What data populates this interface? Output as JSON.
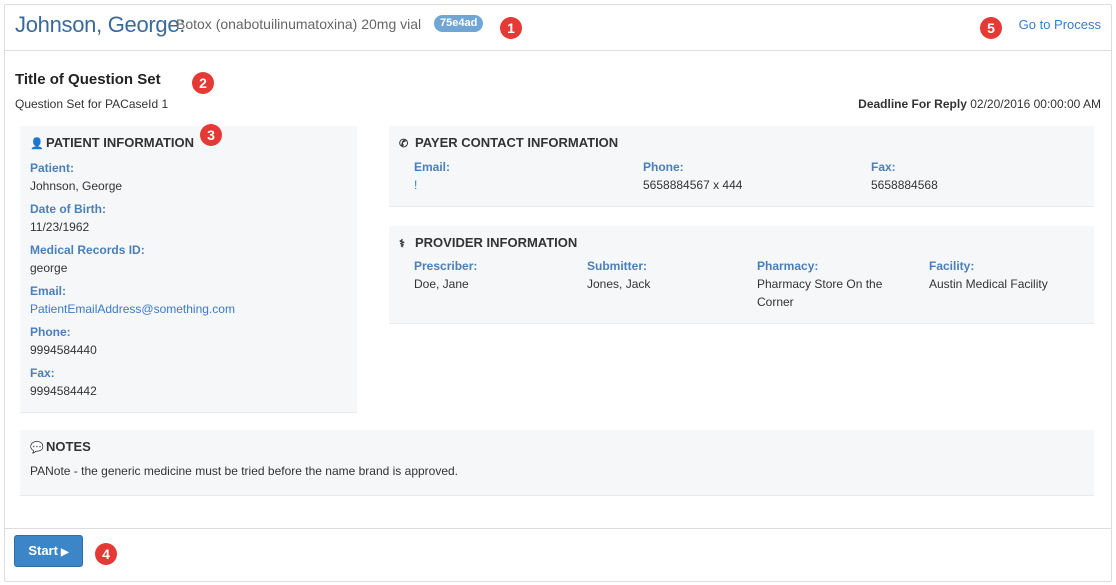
{
  "header": {
    "patient_name": "Johnson, George:",
    "drug": "Botox (onabotuilinumatoxina) 20mg vial",
    "badge": "75e4ad",
    "go_link": "Go to Process"
  },
  "markers": [
    "1",
    "2",
    "3",
    "4",
    "5"
  ],
  "question_set": {
    "title": "Title of Question Set",
    "subtitle": "Question Set for PACaseId 1",
    "deadline_label": "Deadline For Reply",
    "deadline_value": "02/20/2016 00:00:00 AM"
  },
  "patient_info": {
    "title": "PATIENT INFORMATION",
    "icon": "user-icon",
    "fields": [
      {
        "label": "Patient:",
        "value": "Johnson, George"
      },
      {
        "label": "Date of Birth:",
        "value": "11/23/1962"
      },
      {
        "label": "Medical Records ID:",
        "value": "george"
      },
      {
        "label": "Email:",
        "value": "PatientEmailAddress@something.com"
      },
      {
        "label": "Phone:",
        "value": "9994584440"
      },
      {
        "label": "Fax:",
        "value": "9994584442"
      }
    ]
  },
  "payer_contact": {
    "title": "PAYER CONTACT INFORMATION",
    "icon": "phone-icon",
    "fields": [
      {
        "label": "Email:",
        "value": "!"
      },
      {
        "label": "Phone:",
        "value": "5658884567 x 444"
      },
      {
        "label": "Fax:",
        "value": "5658884568"
      }
    ]
  },
  "provider_info": {
    "title": "PROVIDER INFORMATION",
    "icon": "doctor-icon",
    "fields": [
      {
        "label": "Prescriber:",
        "value": "Doe, Jane"
      },
      {
        "label": "Submitter:",
        "value": "Jones, Jack"
      },
      {
        "label": "Pharmacy:",
        "value": "Pharmacy Store On the",
        "value2": "Corner"
      },
      {
        "label": "Facility:",
        "value": "Austin Medical Facility"
      }
    ]
  },
  "notes": {
    "title": "NOTES",
    "icon": "comment-icon",
    "text": "PANote - the generic medicine must be tried before the name brand is approved."
  },
  "footer": {
    "start_label": "Start"
  },
  "colors": {
    "marker": "#e53935",
    "link": "#3a7bc8",
    "label": "#4a7fb8",
    "button": "#3c86c8",
    "badge": "#6fa6d6"
  }
}
